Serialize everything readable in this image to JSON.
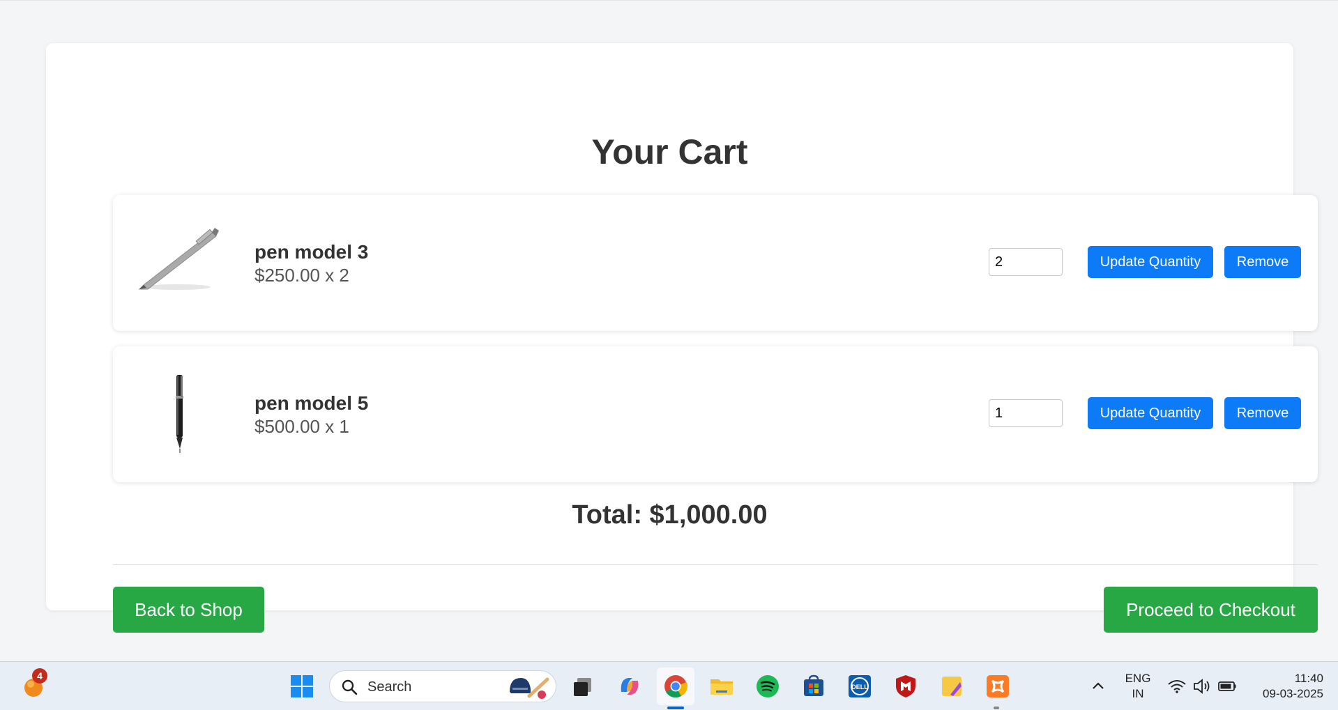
{
  "cart": {
    "title": "Your Cart",
    "items": [
      {
        "name": "pen model 3",
        "price_line": "$250.00 x 2",
        "quantity": "2",
        "image_icon": "silver-pen-image"
      },
      {
        "name": "pen model 5",
        "price_line": "$500.00 x 1",
        "quantity": "1",
        "image_icon": "black-pen-image"
      }
    ],
    "update_label": "Update Quantity",
    "remove_label": "Remove",
    "total": "Total: $1,000.00",
    "back_label": "Back to Shop",
    "checkout_label": "Proceed to Checkout"
  },
  "colors": {
    "primary_blue": "#0d7bf7",
    "success_green": "#28a745",
    "background": "#f4f5f7"
  },
  "taskbar": {
    "notification_count": "4",
    "search_placeholder": "Search",
    "language_line1": "ENG",
    "language_line2": "IN",
    "time": "11:40",
    "date": "09-03-2025",
    "icons": [
      "weather-icon",
      "windows-start-icon",
      "task-view-icon",
      "copilot-icon",
      "chrome-icon",
      "file-explorer-icon",
      "spotify-icon",
      "microsoft-store-icon",
      "dell-icon",
      "mcafee-icon",
      "sticky-notes-icon",
      "xampp-icon",
      "chevron-up-icon",
      "wifi-icon",
      "volume-icon",
      "battery-icon"
    ]
  }
}
